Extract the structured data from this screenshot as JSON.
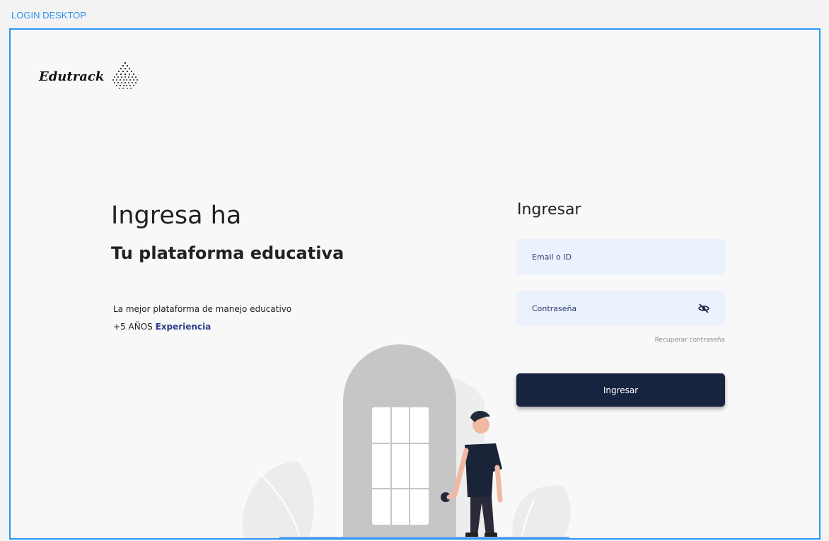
{
  "frame": {
    "label": "LOGIN DESKTOP"
  },
  "brand": {
    "name": "Edutrack",
    "logo_icon": "dotted-fan-icon"
  },
  "hero": {
    "title": "Ingresa ha",
    "subtitle": "Tu plataforma educativa",
    "description": "La mejor plataforma de manejo educativo",
    "years_prefix": "+5 AÑOS ",
    "years_accent": "Experiencia"
  },
  "login_form": {
    "title": "Ingresar",
    "email_placeholder": "Email o ID",
    "password_placeholder": "Contraseña",
    "password_toggle_icon": "eye-slash-icon",
    "recover_label": "Recuperar contraseña",
    "submit_label": "Ingresar"
  },
  "colors": {
    "frame_border": "#2d97f3",
    "input_background": "#ebf2fd",
    "button_background": "#172440",
    "accent_text": "#2d3f8c"
  },
  "illustration": {
    "icon": "person-at-door-illustration"
  }
}
